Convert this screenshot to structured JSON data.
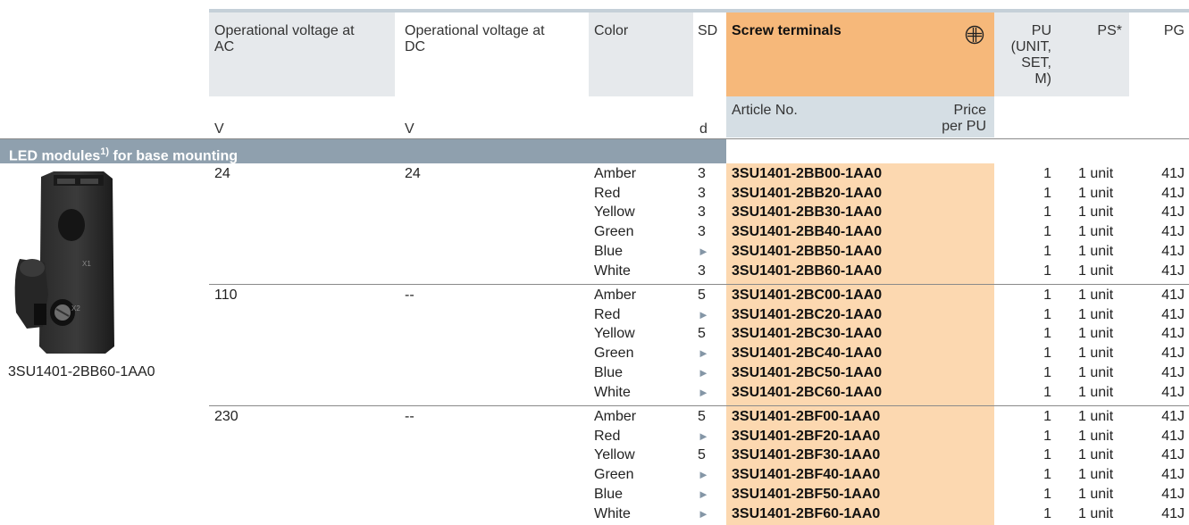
{
  "headers": {
    "ac": "Operational voltage at AC",
    "dc": "Operational voltage at DC",
    "color": "Color",
    "sd": "SD",
    "screw": "Screw terminals",
    "pu": "PU (UNIT, SET, M)",
    "ps": "PS*",
    "pg": "PG",
    "article": "Article No.",
    "price": "Price per PU",
    "unit_v1": "V",
    "unit_v2": "V",
    "unit_d": "d"
  },
  "section": {
    "title": "LED modules",
    "sup": "1)",
    "title_rest": " for base mounting"
  },
  "product": {
    "caption": "3SU1401-2BB60-1AA0"
  },
  "groups": [
    {
      "ac": "24",
      "dc": "24",
      "rows": [
        {
          "color": "Amber",
          "sd": "3",
          "article": "3SU1401-2BB00-1AA0",
          "pu": "1",
          "ps": "1 unit",
          "pg": "41J"
        },
        {
          "color": "Red",
          "sd": "3",
          "article": "3SU1401-2BB20-1AA0",
          "pu": "1",
          "ps": "1 unit",
          "pg": "41J"
        },
        {
          "color": "Yellow",
          "sd": "3",
          "article": "3SU1401-2BB30-1AA0",
          "pu": "1",
          "ps": "1 unit",
          "pg": "41J"
        },
        {
          "color": "Green",
          "sd": "3",
          "article": "3SU1401-2BB40-1AA0",
          "pu": "1",
          "ps": "1 unit",
          "pg": "41J"
        },
        {
          "color": "Blue",
          "sd": "►",
          "article": "3SU1401-2BB50-1AA0",
          "pu": "1",
          "ps": "1 unit",
          "pg": "41J"
        },
        {
          "color": "White",
          "sd": "3",
          "article": "3SU1401-2BB60-1AA0",
          "pu": "1",
          "ps": "1 unit",
          "pg": "41J"
        }
      ]
    },
    {
      "ac": "110",
      "dc": "--",
      "rows": [
        {
          "color": "Amber",
          "sd": "5",
          "article": "3SU1401-2BC00-1AA0",
          "pu": "1",
          "ps": "1 unit",
          "pg": "41J"
        },
        {
          "color": "Red",
          "sd": "►",
          "article": "3SU1401-2BC20-1AA0",
          "pu": "1",
          "ps": "1 unit",
          "pg": "41J"
        },
        {
          "color": "Yellow",
          "sd": "5",
          "article": "3SU1401-2BC30-1AA0",
          "pu": "1",
          "ps": "1 unit",
          "pg": "41J"
        },
        {
          "color": "Green",
          "sd": "►",
          "article": "3SU1401-2BC40-1AA0",
          "pu": "1",
          "ps": "1 unit",
          "pg": "41J"
        },
        {
          "color": "Blue",
          "sd": "►",
          "article": "3SU1401-2BC50-1AA0",
          "pu": "1",
          "ps": "1 unit",
          "pg": "41J"
        },
        {
          "color": "White",
          "sd": "►",
          "article": "3SU1401-2BC60-1AA0",
          "pu": "1",
          "ps": "1 unit",
          "pg": "41J"
        }
      ]
    },
    {
      "ac": "230",
      "dc": "--",
      "rows": [
        {
          "color": "Amber",
          "sd": "5",
          "article": "3SU1401-2BF00-1AA0",
          "pu": "1",
          "ps": "1 unit",
          "pg": "41J"
        },
        {
          "color": "Red",
          "sd": "►",
          "article": "3SU1401-2BF20-1AA0",
          "pu": "1",
          "ps": "1 unit",
          "pg": "41J"
        },
        {
          "color": "Yellow",
          "sd": "5",
          "article": "3SU1401-2BF30-1AA0",
          "pu": "1",
          "ps": "1 unit",
          "pg": "41J"
        },
        {
          "color": "Green",
          "sd": "►",
          "article": "3SU1401-2BF40-1AA0",
          "pu": "1",
          "ps": "1 unit",
          "pg": "41J"
        },
        {
          "color": "Blue",
          "sd": "►",
          "article": "3SU1401-2BF50-1AA0",
          "pu": "1",
          "ps": "1 unit",
          "pg": "41J"
        },
        {
          "color": "White",
          "sd": "►",
          "article": "3SU1401-2BF60-1AA0",
          "pu": "1",
          "ps": "1 unit",
          "pg": "41J"
        }
      ]
    }
  ],
  "colors": {
    "header_band": "#c5d0d8",
    "header_gray": "#e6e9ec",
    "orange_header": "#f6b87a",
    "orange_column": "#fcd8b0",
    "subheader_blue": "#d5dee4",
    "section_bar": "#8fa0ae"
  }
}
